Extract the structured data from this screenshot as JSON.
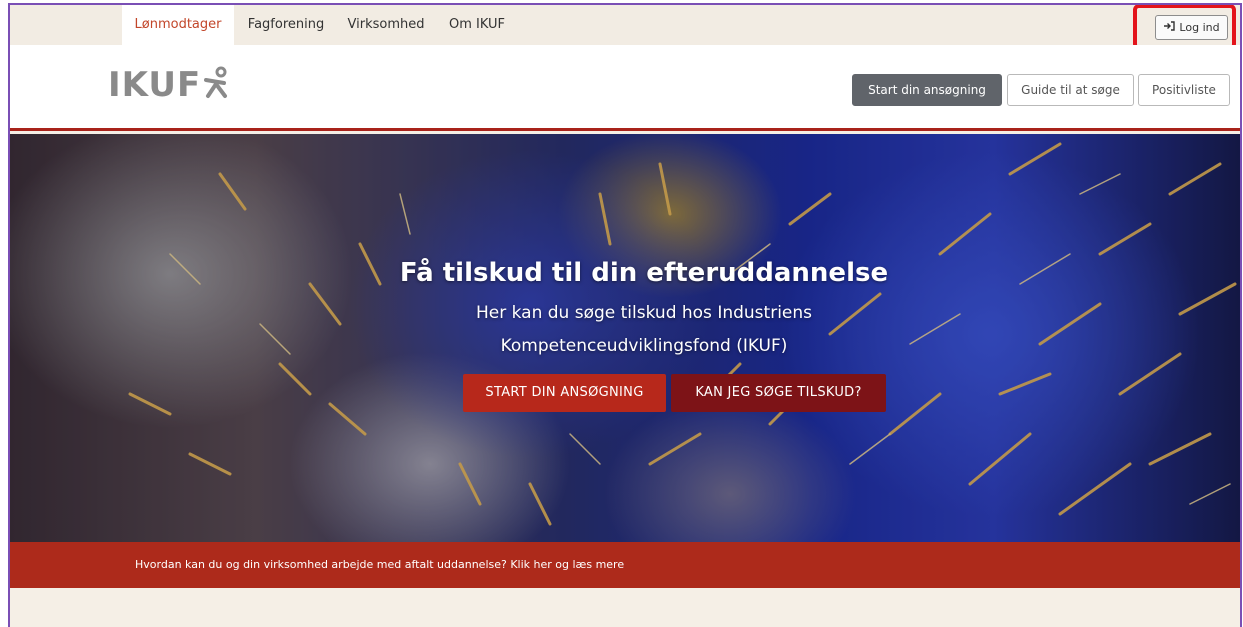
{
  "topnav": {
    "tabs": [
      {
        "label": "Lønmodtager",
        "active": true
      },
      {
        "label": "Fagforening",
        "active": false
      },
      {
        "label": "Virksomhed",
        "active": false
      },
      {
        "label": "Om IKUF",
        "active": false
      }
    ],
    "login_label": "Log ind",
    "login_icon": "sign-in-icon"
  },
  "header": {
    "logo_text": "IKUF",
    "buttons": {
      "start": "Start din ansøgning",
      "guide": "Guide til at søge",
      "positive": "Positivliste"
    }
  },
  "hero": {
    "title": "Få tilskud til din efteruddannelse",
    "subtitle_line1": "Her kan du søge tilskud hos Industriens",
    "subtitle_line2": "Kompetenceudviklingsfond (IKUF)",
    "cta_primary": "START DIN ANSØGNING",
    "cta_secondary": "KAN JEG SØGE TILSKUD?"
  },
  "banner": {
    "text": "Hvordan kan du og din virksomhed arbejde med aftalt uddannelse? Klik her og læs mere"
  },
  "colors": {
    "accent_red": "#b7281b",
    "dark_red": "#7d1317",
    "banner_red": "#ad2a1b",
    "highlight": "#e3141b",
    "active_tab": "#c2462a"
  }
}
